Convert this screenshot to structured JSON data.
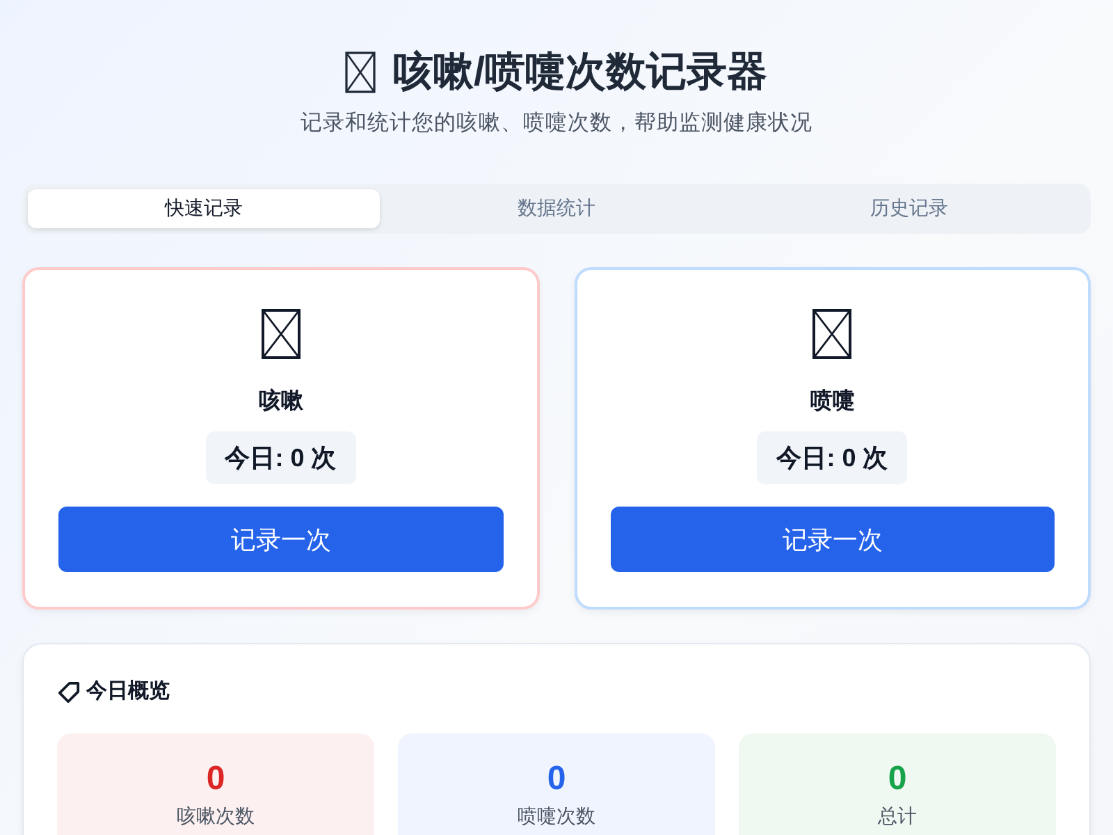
{
  "header": {
    "title": "咳嗽/喷嚏次数记录器",
    "subtitle": "记录和统计您的咳嗽、喷嚏次数，帮助监测健康状况"
  },
  "tabs": [
    {
      "label": "快速记录",
      "selected": true
    },
    {
      "label": "数据统计",
      "selected": false
    },
    {
      "label": "历史记录",
      "selected": false
    }
  ],
  "counters": [
    {
      "name": "咳嗽",
      "today": "今日: 0 次",
      "button": "记录一次",
      "color": "#fecaca"
    },
    {
      "name": "喷嚏",
      "today": "今日: 0 次",
      "button": "记录一次",
      "color": "#bfdbfe"
    }
  ],
  "overview": {
    "title": "今日概览",
    "stats": [
      {
        "value": "0",
        "label": "咳嗽次数",
        "color": "#dc2626"
      },
      {
        "value": "0",
        "label": "喷嚏次数",
        "color": "#2563eb"
      },
      {
        "value": "0",
        "label": "总计",
        "color": "#16a34a"
      }
    ]
  }
}
